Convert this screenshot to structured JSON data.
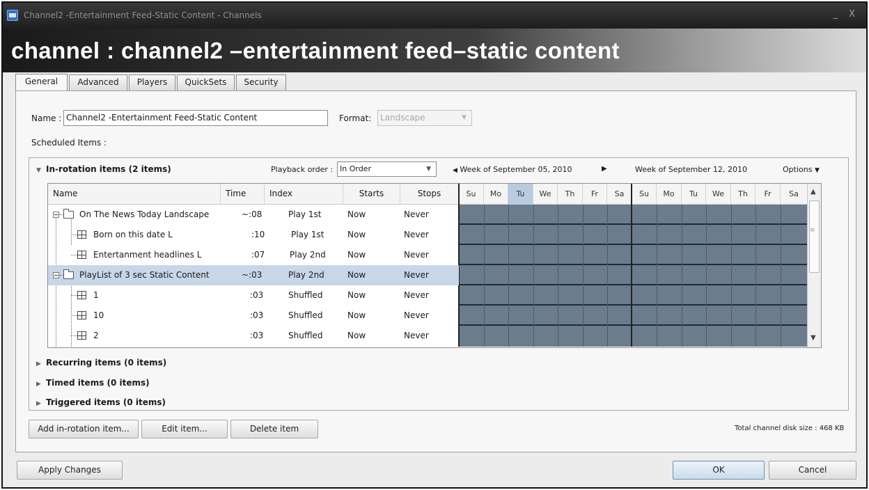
{
  "window": {
    "title": "Channel2 -Entertainment Feed-Static Content - Channels",
    "controls": "_ X"
  },
  "banner": {
    "title": "channel : channel2 –entertainment feed–static content"
  },
  "tabs": [
    "General",
    "Advanced",
    "Players",
    "QuickSets",
    "Security"
  ],
  "form": {
    "name_label": "Name :",
    "name_value": "Channel2 -Entertainment Feed-Static Content",
    "format_label": "Format:",
    "format_value": "Landscape",
    "scheduled_label": "Scheduled Items :"
  },
  "rotation": {
    "header": "In-rotation items (2 items)",
    "playback_label": "Playback order :",
    "playback_value": "In Order",
    "week1": "Week of September 05, 2010",
    "week2": "Week of September 12, 2010",
    "options": "Options"
  },
  "columns": [
    "Name",
    "Time",
    "Index",
    "Starts",
    "Stops"
  ],
  "days": [
    "Su",
    "Mo",
    "Tu",
    "We",
    "Th",
    "Fr",
    "Sa",
    "Su",
    "Mo",
    "Tu",
    "We",
    "Th",
    "Fr",
    "Sa"
  ],
  "rows": [
    {
      "name": "On The News Today Landscape",
      "time": "~:08",
      "index": "Play 1st",
      "starts": "Now",
      "stops": "Never"
    },
    {
      "name": "Born on this date L",
      "time": ":10",
      "index": "Play 1st",
      "starts": "Now",
      "stops": "Never"
    },
    {
      "name": "Entertanment headlines L",
      "time": ":07",
      "index": "Play 2nd",
      "starts": "Now",
      "stops": "Never"
    },
    {
      "name": "PlayList of 3 sec Static Content",
      "time": "~:03",
      "index": "Play 2nd",
      "starts": "Now",
      "stops": "Never"
    },
    {
      "name": "1",
      "time": ":03",
      "index": "Shuffled",
      "starts": "Now",
      "stops": "Never"
    },
    {
      "name": "10",
      "time": ":03",
      "index": "Shuffled",
      "starts": "Now",
      "stops": "Never"
    },
    {
      "name": "2",
      "time": ":03",
      "index": "Shuffled",
      "starts": "Now",
      "stops": "Never"
    }
  ],
  "sections": {
    "recurring": "Recurring items (0 items)",
    "timed": "Timed items (0 items)",
    "triggered": "Triggered items (0 items)"
  },
  "buttons": {
    "add": "Add in-rotation item...",
    "edit": "Edit item...",
    "delete": "Delete item",
    "apply": "Apply Changes",
    "ok": "OK",
    "cancel": "Cancel"
  },
  "disk_size": "Total channel disk size : 468 KB",
  "colors": {
    "calendar_fill": "#6b7c8c",
    "selected_row": "#c7d7e7",
    "today_header": "#b9cbe0"
  }
}
